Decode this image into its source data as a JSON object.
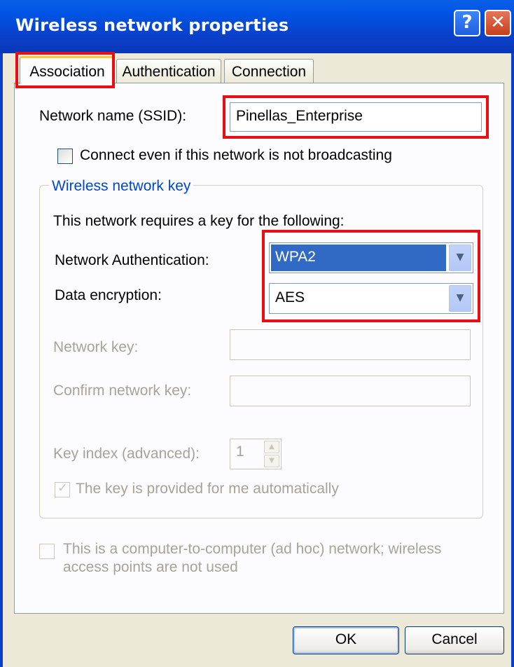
{
  "window": {
    "title": "Wireless network properties",
    "help_glyph": "?",
    "close_glyph": "✕"
  },
  "tabs": [
    {
      "label": "Association",
      "active": true
    },
    {
      "label": "Authentication",
      "active": false
    },
    {
      "label": "Connection",
      "active": false
    }
  ],
  "association": {
    "ssid_label": "Network name (SSID):",
    "ssid_value": "Pinellas_Enterprise",
    "broadcast_checkbox_label": "Connect even if this network is not broadcasting",
    "broadcast_checked": false,
    "group_title": "Wireless network key",
    "requires_text": "This network requires a key for the following:",
    "auth_label": "Network Authentication:",
    "auth_value": "WPA2",
    "encryption_label": "Data encryption:",
    "encryption_value": "AES",
    "network_key_label": "Network key:",
    "network_key_value": "",
    "confirm_key_label": "Confirm network key:",
    "confirm_key_value": "",
    "key_index_label": "Key index (advanced):",
    "key_index_value": "1",
    "auto_key_label": "The key is provided for me automatically",
    "auto_key_checked": true,
    "adhoc_label_line1": "This is a computer-to-computer (ad hoc) network; wireless",
    "adhoc_label_line2": "access points are not used",
    "adhoc_checked": false
  },
  "buttons": {
    "ok": "OK",
    "cancel": "Cancel"
  },
  "colors": {
    "highlight_box": "#e60f14",
    "titlebar": "#0054e3",
    "group_title": "#0046d5",
    "selection": "#316ac5"
  }
}
